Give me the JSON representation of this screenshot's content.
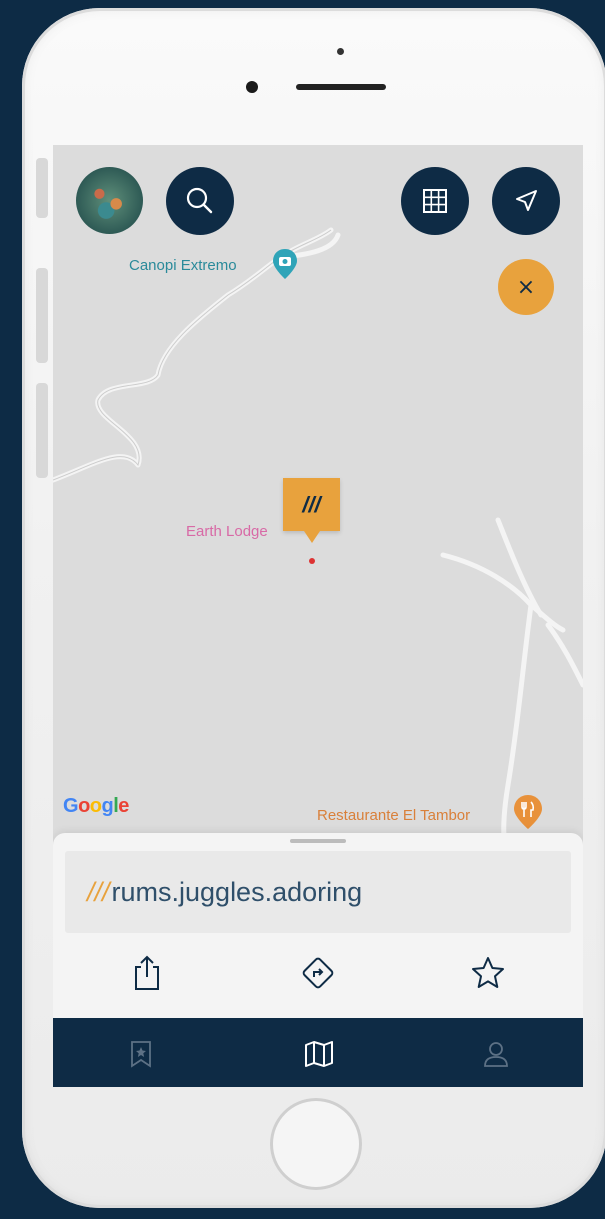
{
  "map": {
    "poi_canopi": "Canopi Extremo",
    "poi_earth": "Earth Lodge",
    "poi_restaurant": "Restaurante El Tambor",
    "google_logo": "Google",
    "marker_glyph": "///"
  },
  "top_controls": {
    "search_icon": "search-icon",
    "grid_icon": "grid-icon",
    "locate_icon": "navigation-arrow-icon",
    "close_glyph": "×"
  },
  "sheet": {
    "slashes": "///",
    "address": "rums.juggles.adoring",
    "actions": [
      "share-icon",
      "directions-icon",
      "star-icon"
    ]
  },
  "tabbar": {
    "tabs": [
      "bookmark-icon",
      "map-icon",
      "profile-icon"
    ]
  },
  "colors": {
    "background": "#0d2b45",
    "navy": "#0e2b45",
    "accent_orange": "#e8a23d",
    "map_bg": "#dcdcdc"
  }
}
